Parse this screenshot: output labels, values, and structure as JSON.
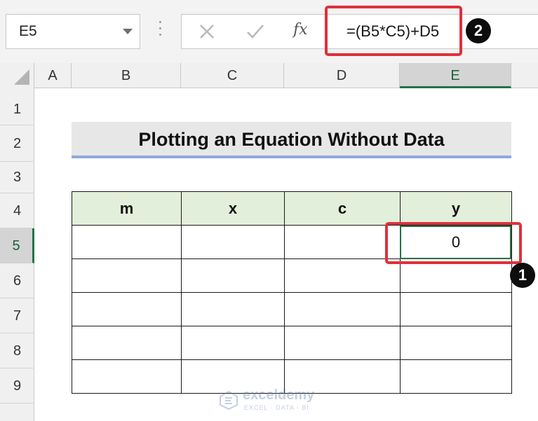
{
  "formula_bar": {
    "name_box": "E5",
    "fx_label": "fx",
    "formula": "=(B5*C5)+D5"
  },
  "columns": [
    "A",
    "B",
    "C",
    "D",
    "E"
  ],
  "rows": [
    "1",
    "2",
    "3",
    "4",
    "5",
    "6",
    "7",
    "8",
    "9"
  ],
  "selected_cell": "E5",
  "sheet": {
    "title": "Plotting an Equation Without Data",
    "table": {
      "headers": [
        "m",
        "x",
        "c",
        "y"
      ],
      "rows": [
        [
          "",
          "",
          "",
          "0"
        ],
        [
          "",
          "",
          "",
          ""
        ],
        [
          "",
          "",
          "",
          ""
        ],
        [
          "",
          "",
          "",
          ""
        ],
        [
          "",
          "",
          "",
          ""
        ]
      ]
    }
  },
  "annotations": {
    "badge_1": "1",
    "badge_2": "2"
  },
  "watermark": {
    "name": "exceldemy",
    "tagline": "EXCEL · DATA · BI"
  },
  "colors": {
    "highlight": "#e0303a",
    "selection": "#217346",
    "header_fill": "#e2efda",
    "title_underline": "#8eaadb"
  }
}
